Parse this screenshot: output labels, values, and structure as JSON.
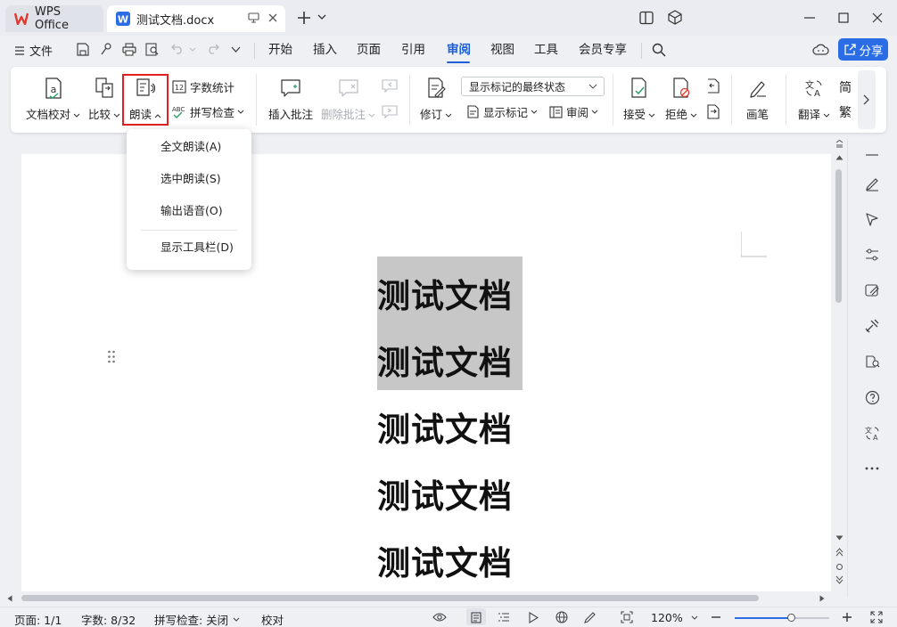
{
  "tabs": {
    "home_label": "WPS Office",
    "doc_label": "测试文档.docx"
  },
  "menu": {
    "file": "文件",
    "items": [
      "开始",
      "插入",
      "页面",
      "引用",
      "审阅",
      "视图",
      "工具",
      "会员专享"
    ],
    "active": "审阅",
    "share": "分享"
  },
  "ribbon": {
    "doc_check": "文档校对",
    "compare": "比较",
    "read_aloud": "朗读",
    "word_count": "字数统计",
    "spell_check": "拼写检查",
    "insert_comment": "插入批注",
    "delete_comment": "删除批注",
    "revise": "修订",
    "display_state": "显示标记的最终状态",
    "show_marks": "显示标记",
    "review": "审阅",
    "accept": "接受",
    "reject": "拒绝",
    "pen": "画笔",
    "translate": "翻译",
    "simp": "简",
    "trad": "繁"
  },
  "dropdown": {
    "items": [
      "全文朗读(A)",
      "选中朗读(S)",
      "输出语音(O)",
      "显示工具栏(D)"
    ]
  },
  "document": {
    "lines": [
      "测试文档",
      "测试文档",
      "测试文档",
      "测试文档",
      "测试文档"
    ]
  },
  "statusbar": {
    "page": "页面: 1/1",
    "word_count": "字数: 8/32",
    "spell_check": "拼写检查: 关闭",
    "proofread": "校对",
    "zoom": "120%",
    "zoom_slider_level": 0.6
  },
  "colors": {
    "accent": "#2b6de4",
    "highlight_box": "#e02020",
    "selection": "#c7c7c7"
  }
}
